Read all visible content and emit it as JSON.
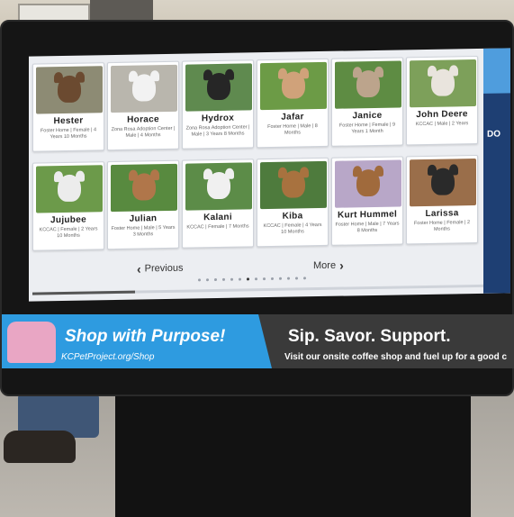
{
  "pets": [
    {
      "name": "Hester",
      "meta": "Foster Home | Female | 4 Years 10 Months",
      "bg": "#8d8b74",
      "fur": "#6b4a30"
    },
    {
      "name": "Horace",
      "meta": "Zona Rosa Adoption Center | Male | 4 Months",
      "bg": "#b9b6ad",
      "fur": "#f2f2f2"
    },
    {
      "name": "Hydrox",
      "meta": "Zona Rosa Adoption Center | Male | 3 Years 8 Months",
      "bg": "#5f8a4f",
      "fur": "#262626"
    },
    {
      "name": "Jafar",
      "meta": "Foster Home | Male | 8 Months",
      "bg": "#6c9b46",
      "fur": "#d0a27a"
    },
    {
      "name": "Janice",
      "meta": "Foster Home | Female | 9 Years 1 Month",
      "bg": "#5e8c43",
      "fur": "#bca48c"
    },
    {
      "name": "John Deere",
      "meta": "KCCAC | Male | 2 Years",
      "bg": "#7da05a",
      "fur": "#e9e4dd"
    },
    {
      "name": "Jujubee",
      "meta": "KCCAC | Female | 2 Years 10 Months",
      "bg": "#6c9a4a",
      "fur": "#ececec"
    },
    {
      "name": "Julian",
      "meta": "Foster Home | Male | 5 Years 3 Months",
      "bg": "#588a3f",
      "fur": "#b0764a"
    },
    {
      "name": "Kalani",
      "meta": "KCCAC | Female | 7 Months",
      "bg": "#5c8c48",
      "fur": "#f0f0f0"
    },
    {
      "name": "Kiba",
      "meta": "KCCAC | Female | 4 Years 10 Months",
      "bg": "#4e7b3d",
      "fur": "#a8723f"
    },
    {
      "name": "Kurt Hummel",
      "meta": "Foster Home | Male | 7 Years 8 Months",
      "bg": "#b8a7c8",
      "fur": "#a06a3c"
    },
    {
      "name": "Larissa",
      "meta": "Foster Home | Female | 2 Months",
      "bg": "#9a6e4a",
      "fur": "#2a2a2a"
    }
  ],
  "nav": {
    "previous": "Previous",
    "more": "More"
  },
  "right_panel": {
    "text": "DO"
  },
  "banner": {
    "left_title": "Shop with Purpose!",
    "left_url": "KCPetProject.org/Shop",
    "right_title": "Sip. Savor. Support.",
    "right_sub": "Visit our onsite coffee shop and fuel up for a good c"
  },
  "pagination": {
    "page_count": 14,
    "active_index": 6
  },
  "scroll_progress": 0.22,
  "colors": {
    "banner_blue": "#2e9be0",
    "panel_navy": "#1e3f73"
  }
}
